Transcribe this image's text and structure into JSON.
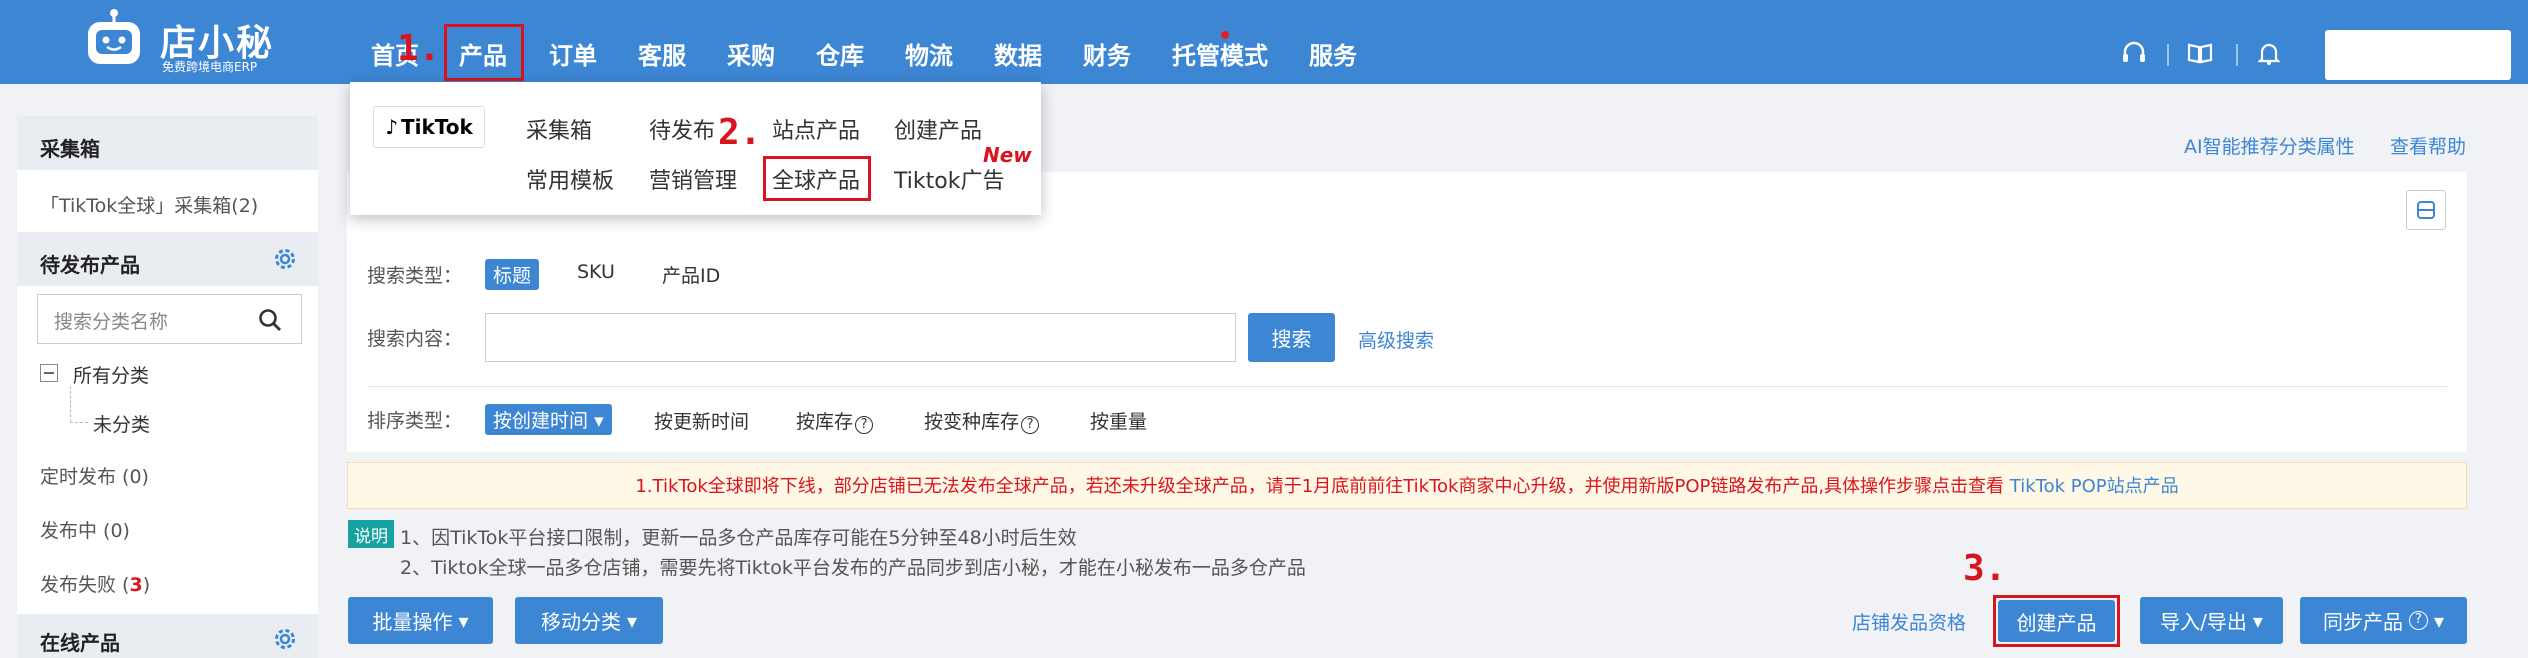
{
  "brand": {
    "name": "店小秘",
    "subtitle": "免费跨境电商ERP"
  },
  "nav": {
    "items": [
      "首页",
      "产品",
      "订单",
      "客服",
      "采购",
      "仓库",
      "物流",
      "数据",
      "财务",
      "托管模式",
      "服务"
    ]
  },
  "steps": [
    "1.",
    "2.",
    "3."
  ],
  "dropdown": {
    "platform": "TikTok",
    "row1": [
      "采集箱",
      "待发布",
      "站点产品",
      "创建产品"
    ],
    "row2": [
      "常用模板",
      "营销管理",
      "全球产品",
      "Tiktok广告"
    ],
    "new_badge": "New"
  },
  "sidebar": {
    "collect_title": "采集箱",
    "collect_item": "「TikTok全球」采集箱(2)",
    "pending_title": "待发布产品",
    "search_placeholder": "搜索分类名称",
    "tree_all": "所有分类",
    "tree_uncat": "未分类",
    "scheduled": "定时发布 (0)",
    "publishing": "发布中 (0)",
    "failed_prefix": "发布失败 (",
    "failed_count": "3",
    "failed_suffix": ")",
    "online_title": "在线产品"
  },
  "header_links": {
    "ai": "AI智能推荐分类属性",
    "help": "查看帮助"
  },
  "search": {
    "type_label": "搜索类型：",
    "types": [
      "标题",
      "SKU",
      "产品ID"
    ],
    "content_label": "搜索内容：",
    "search_btn": "搜索",
    "advanced": "高级搜索",
    "sort_label": "排序类型：",
    "sorts": [
      "按创建时间",
      "按更新时间",
      "按库存",
      "按变种库存",
      "按重量"
    ]
  },
  "notice": {
    "text": "1.TikTok全球即将下线，部分店铺已无法发布全球产品，若还未升级全球产品，请于1月底前前往TikTok商家中心升级，并使用新版POP链路发布产品,具体操作步骤点击查看",
    "link": "TikTok POP站点产品"
  },
  "explain": {
    "badge": "说明",
    "line1": "1、因TikTok平台接口限制，更新一品多仓产品库存可能在5分钟至48小时后生效",
    "line2": "2、Tiktok全球一品多仓店铺，需要先将Tiktok平台发布的产品同步到店小秘，才能在小秘发布一品多仓产品"
  },
  "actions": {
    "batch": "批量操作",
    "move": "移动分类",
    "qualify": "店铺发品资格",
    "create": "创建产品",
    "import_export": "导入/导出",
    "sync": "同步产品"
  },
  "colors": {
    "brand_blue": "#3d86d4",
    "accent_red": "#d9141e",
    "teal_badge": "#17a2a2"
  }
}
